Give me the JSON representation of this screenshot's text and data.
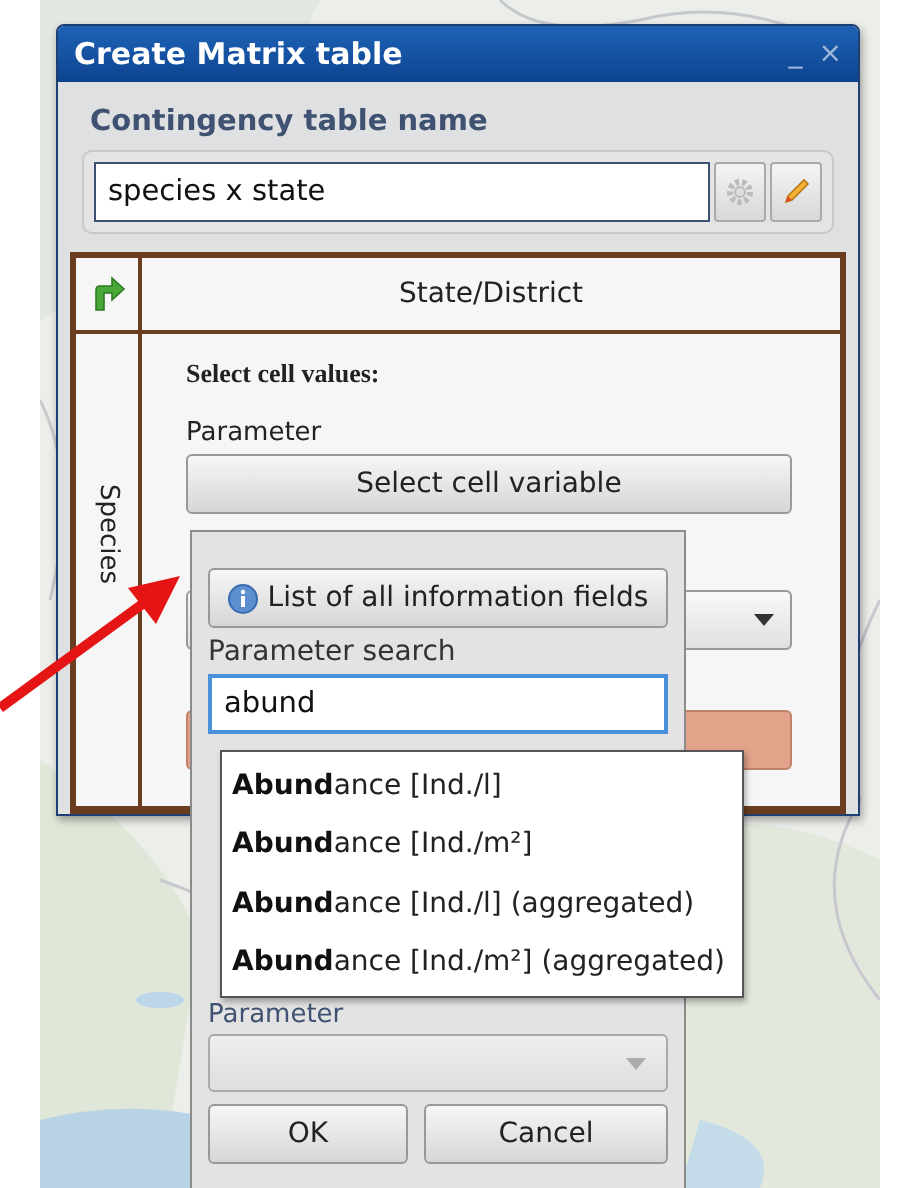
{
  "dialog": {
    "title": "Create Matrix table",
    "minimize": "_",
    "close": "×"
  },
  "name_section": {
    "label": "Contingency table name",
    "value": "species x state"
  },
  "matrix": {
    "column_header": "State/District",
    "row_header": "Species",
    "heading": "Select cell values:",
    "parameter_label": "Parameter",
    "select_button": "Select cell variable"
  },
  "popup": {
    "list_button": "List of all information fields",
    "search_label": "Parameter search",
    "search_value": "abund",
    "suggestions": [
      {
        "text": "**Abund**ance [Ind./l]"
      },
      {
        "text": "**Abund**ance [Ind./m²]"
      },
      {
        "text": "**Abund**ance [Ind./l] (aggregated)"
      },
      {
        "text": "**Abund**ance [Ind./m²] (aggregated)"
      }
    ],
    "parameter_label": "Parameter",
    "parameter_dropdown": {
      "disabled": true
    },
    "buttons": [
      "OK",
      "Cancel"
    ]
  }
}
